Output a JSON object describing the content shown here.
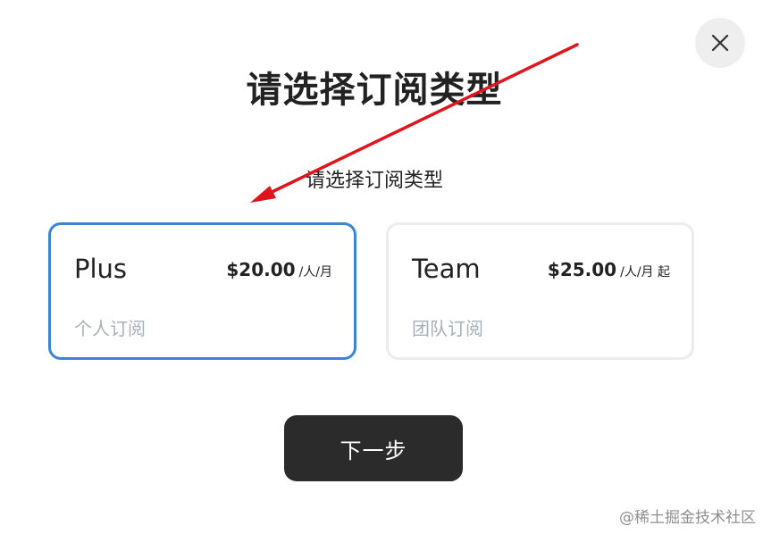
{
  "dialog": {
    "title": "请选择订阅类型",
    "subtitle": "请选择订阅类型",
    "close_icon": "close-icon"
  },
  "plans": [
    {
      "name": "Plus",
      "price": "$20.00",
      "unit": "/人/月",
      "description": "个人订阅",
      "selected": true
    },
    {
      "name": "Team",
      "price": "$25.00",
      "unit": "/人/月 起",
      "description": "团队订阅",
      "selected": false
    }
  ],
  "next_button": "下一步",
  "watermark": "@稀土掘金技术社区",
  "colors": {
    "selected_border": "#3a86d4",
    "unselected_border": "#ececec",
    "button_bg": "#2b2b2b",
    "annotation_arrow": "#e0141c"
  }
}
